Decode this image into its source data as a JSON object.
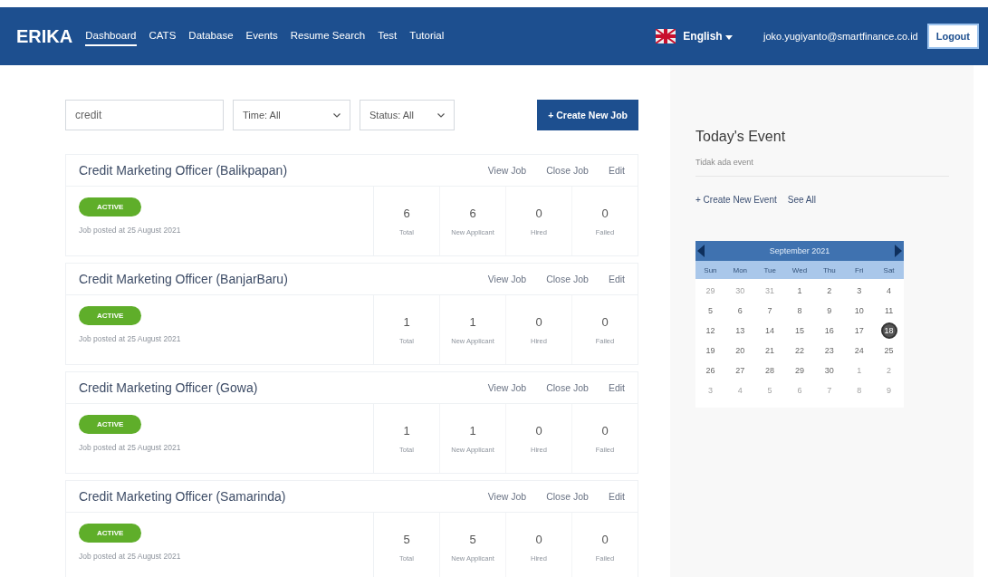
{
  "navbar": {
    "brand": "ERIKA",
    "links": [
      {
        "label": "Dashboard",
        "selected": true
      },
      {
        "label": "CATS",
        "selected": false
      },
      {
        "label": "Database",
        "selected": false
      },
      {
        "label": "Events",
        "selected": false
      },
      {
        "label": "Resume Search",
        "selected": false
      },
      {
        "label": "Test",
        "selected": false
      },
      {
        "label": "Tutorial",
        "selected": false
      }
    ],
    "language": "English",
    "user": "joko.yugiyanto@smartfinance.co.id",
    "logout": "Logout"
  },
  "filters": {
    "search": "credit",
    "time": "Time: All",
    "status": "Status: All",
    "create_button": "+ Create New Job"
  },
  "jobs": [
    {
      "title": "Credit Marketing Officer (Balikpapan)",
      "actions": [
        "View Job",
        "Close Job",
        "Edit"
      ],
      "status": "ACTIVE",
      "posted": "Job posted at 25 August 2021",
      "stats": [
        {
          "value": "6",
          "label": "Total"
        },
        {
          "value": "6",
          "label": "New Applicant"
        },
        {
          "value": "0",
          "label": "Hired"
        },
        {
          "value": "0",
          "label": "Failed"
        }
      ]
    },
    {
      "title": "Credit Marketing Officer (BanjarBaru)",
      "actions": [
        "View Job",
        "Close Job",
        "Edit"
      ],
      "status": "ACTIVE",
      "posted": "Job posted at 25 August 2021",
      "stats": [
        {
          "value": "1",
          "label": "Total"
        },
        {
          "value": "1",
          "label": "New Applicant"
        },
        {
          "value": "0",
          "label": "Hired"
        },
        {
          "value": "0",
          "label": "Failed"
        }
      ]
    },
    {
      "title": "Credit Marketing Officer (Gowa)",
      "actions": [
        "View Job",
        "Close Job",
        "Edit"
      ],
      "status": "ACTIVE",
      "posted": "Job posted at 25 August 2021",
      "stats": [
        {
          "value": "1",
          "label": "Total"
        },
        {
          "value": "1",
          "label": "New Applicant"
        },
        {
          "value": "0",
          "label": "Hired"
        },
        {
          "value": "0",
          "label": "Failed"
        }
      ]
    },
    {
      "title": "Credit Marketing Officer (Samarinda)",
      "actions": [
        "View Job",
        "Close Job",
        "Edit"
      ],
      "status": "ACTIVE",
      "posted": "Job posted at 25 August 2021",
      "stats": [
        {
          "value": "5",
          "label": "Total"
        },
        {
          "value": "5",
          "label": "New Applicant"
        },
        {
          "value": "0",
          "label": "Hired"
        },
        {
          "value": "0",
          "label": "Failed"
        }
      ]
    }
  ],
  "todays_event": {
    "title": "Today's Event",
    "empty_text": "Tidak ada event",
    "create_link": "+ Create New Event",
    "see_all": "See All"
  },
  "calendar": {
    "month": "September 2021",
    "weekdays": [
      "Sun",
      "Mon",
      "Tue",
      "Wed",
      "Thu",
      "Fri",
      "Sat"
    ],
    "days": [
      {
        "label": "29",
        "muted": true,
        "selected": false
      },
      {
        "label": "30",
        "muted": true,
        "selected": false
      },
      {
        "label": "31",
        "muted": true,
        "selected": false
      },
      {
        "label": "1",
        "muted": false,
        "selected": false
      },
      {
        "label": "2",
        "muted": false,
        "selected": false
      },
      {
        "label": "3",
        "muted": false,
        "selected": false
      },
      {
        "label": "4",
        "muted": false,
        "selected": false
      },
      {
        "label": "5",
        "muted": false,
        "selected": false
      },
      {
        "label": "6",
        "muted": false,
        "selected": false
      },
      {
        "label": "7",
        "muted": false,
        "selected": false
      },
      {
        "label": "8",
        "muted": false,
        "selected": false
      },
      {
        "label": "9",
        "muted": false,
        "selected": false
      },
      {
        "label": "10",
        "muted": false,
        "selected": false
      },
      {
        "label": "11",
        "muted": false,
        "selected": false
      },
      {
        "label": "12",
        "muted": false,
        "selected": false
      },
      {
        "label": "13",
        "muted": false,
        "selected": false
      },
      {
        "label": "14",
        "muted": false,
        "selected": false
      },
      {
        "label": "15",
        "muted": false,
        "selected": false
      },
      {
        "label": "16",
        "muted": false,
        "selected": false
      },
      {
        "label": "17",
        "muted": false,
        "selected": false
      },
      {
        "label": "18",
        "muted": false,
        "selected": true
      },
      {
        "label": "19",
        "muted": false,
        "selected": false
      },
      {
        "label": "20",
        "muted": false,
        "selected": false
      },
      {
        "label": "21",
        "muted": false,
        "selected": false
      },
      {
        "label": "22",
        "muted": false,
        "selected": false
      },
      {
        "label": "23",
        "muted": false,
        "selected": false
      },
      {
        "label": "24",
        "muted": false,
        "selected": false
      },
      {
        "label": "25",
        "muted": false,
        "selected": false
      },
      {
        "label": "26",
        "muted": false,
        "selected": false
      },
      {
        "label": "27",
        "muted": false,
        "selected": false
      },
      {
        "label": "28",
        "muted": false,
        "selected": false
      },
      {
        "label": "29",
        "muted": false,
        "selected": false
      },
      {
        "label": "30",
        "muted": false,
        "selected": false
      },
      {
        "label": "1",
        "muted": true,
        "selected": false
      },
      {
        "label": "2",
        "muted": true,
        "selected": false
      },
      {
        "label": "3",
        "muted": true,
        "selected": false
      },
      {
        "label": "4",
        "muted": true,
        "selected": false
      },
      {
        "label": "5",
        "muted": true,
        "selected": false
      },
      {
        "label": "6",
        "muted": true,
        "selected": false
      },
      {
        "label": "7",
        "muted": true,
        "selected": false
      },
      {
        "label": "8",
        "muted": true,
        "selected": false
      },
      {
        "label": "9",
        "muted": true,
        "selected": false
      }
    ]
  }
}
